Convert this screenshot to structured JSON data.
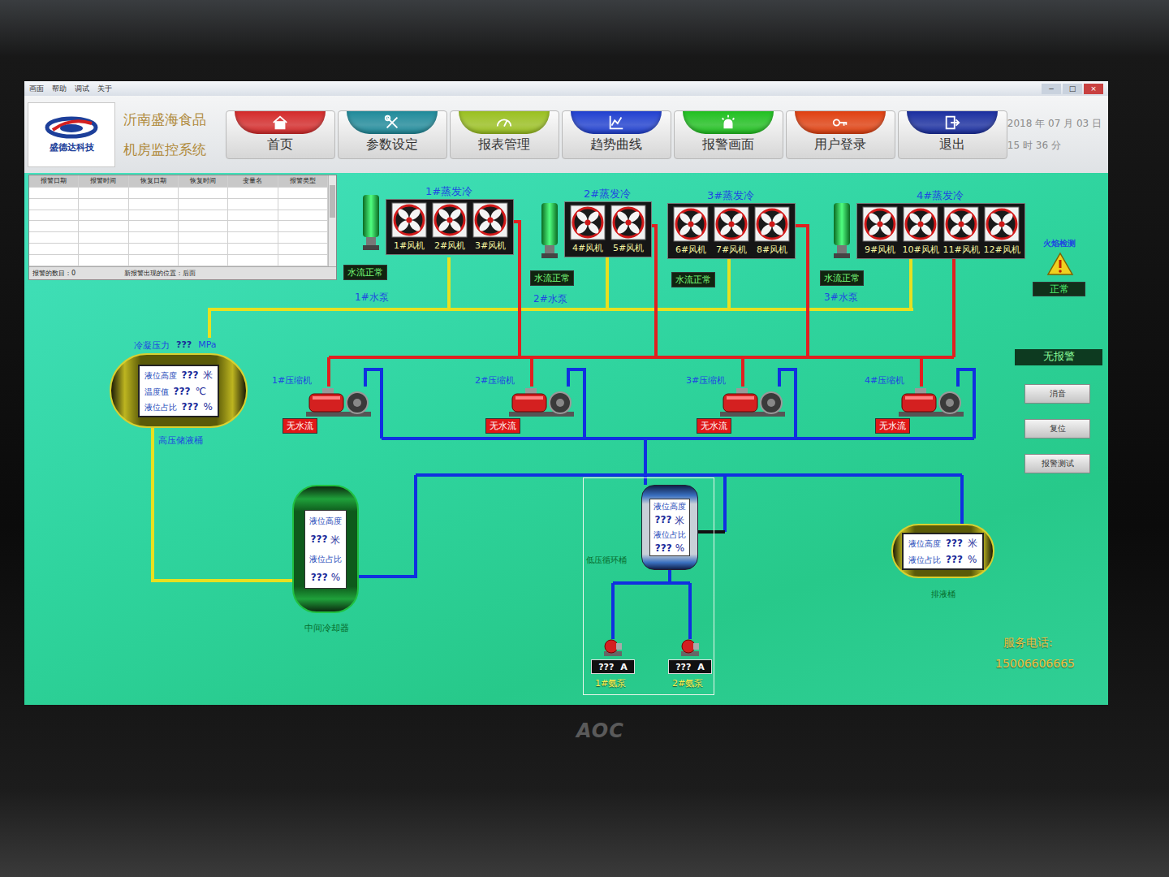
{
  "window": {
    "menu": [
      "画面",
      "帮助",
      "调试",
      "关于"
    ],
    "controls": [
      "−",
      "□",
      "×"
    ]
  },
  "header": {
    "logo": "盛德达科技",
    "company": "沂南盛海食品",
    "system": "机房监控系统",
    "date": "2018 年 07 月 03 日",
    "time": "15 时 36 分"
  },
  "nav": [
    {
      "label": "首页",
      "color": "#d42a2a"
    },
    {
      "label": "参数设定",
      "color": "#1f8a9a"
    },
    {
      "label": "报表管理",
      "color": "#9ac020"
    },
    {
      "label": "趋势曲线",
      "color": "#2040d0"
    },
    {
      "label": "报警画面",
      "color": "#20c020"
    },
    {
      "label": "用户登录",
      "color": "#e04010"
    },
    {
      "label": "退出",
      "color": "#1a2ea0"
    }
  ],
  "alarm_table": {
    "columns": [
      "报警日期",
      "报警时间",
      "恢复日期",
      "恢复时间",
      "变量名",
      "报警类型"
    ],
    "rows": [],
    "count": "报警的数目：0",
    "position": "新报警出现的位置：后面"
  },
  "condensers": [
    {
      "title": "1#蒸发冷",
      "fans": [
        "1#风机",
        "2#风机",
        "3#风机"
      ],
      "flow": "水流正常",
      "flow_ok": true,
      "pump": "1#水泵"
    },
    {
      "title": "2#蒸发冷",
      "fans": [
        "4#风机",
        "5#风机"
      ],
      "flow": "水流正常",
      "flow_ok": true,
      "pump": "2#水泵"
    },
    {
      "title": "3#蒸发冷",
      "fans": [
        "6#风机",
        "7#风机",
        "8#风机"
      ],
      "flow": "水流正常",
      "flow_ok": true
    },
    {
      "title": "4#蒸发冷",
      "fans": [
        "9#风机",
        "10#风机",
        "11#风机",
        "12#风机"
      ],
      "flow": "水流正常",
      "flow_ok": true,
      "pump": "3#水泵"
    }
  ],
  "compressors": [
    {
      "label": "1#压缩机",
      "status": "无水流",
      "flow_ok": false
    },
    {
      "label": "2#压缩机",
      "status": "无水流",
      "flow_ok": false
    },
    {
      "label": "3#压缩机",
      "status": "无水流",
      "flow_ok": false
    },
    {
      "label": "4#压缩机",
      "status": "无水流",
      "flow_ok": false
    }
  ],
  "fire": {
    "title": "火焰检测",
    "status": "正常",
    "ok": true
  },
  "alarm_status": "无报警",
  "buttons": [
    "消音",
    "复位",
    "报警测试"
  ],
  "receiver": {
    "title_label": "冷凝压力",
    "title_value": "???",
    "title_unit": "MPa",
    "rows": [
      {
        "label": "液位高度",
        "value": "???",
        "unit": "米"
      },
      {
        "label": "温度值",
        "value": "???",
        "unit": "℃"
      },
      {
        "label": "液位占比",
        "value": "???",
        "unit": "%"
      }
    ],
    "name": "高压储液桶"
  },
  "cooler": {
    "rows": [
      {
        "label": "液位高度",
        "value": "???",
        "unit": "米"
      },
      {
        "label": "液位占比",
        "value": "???",
        "unit": "%"
      }
    ],
    "name": "中间冷却器"
  },
  "low_barrel": {
    "rows": [
      {
        "label": "液位高度",
        "value": "???",
        "unit": "米"
      },
      {
        "label": "液位占比",
        "value": "???",
        "unit": "%"
      }
    ],
    "name": "低压循环桶",
    "pumps": [
      {
        "value": "???",
        "unit": "A",
        "name": "1#氨泵"
      },
      {
        "value": "???",
        "unit": "A",
        "name": "2#氨泵"
      }
    ]
  },
  "drain": {
    "rows": [
      {
        "label": "液位高度",
        "value": "???",
        "unit": "米"
      },
      {
        "label": "液位占比",
        "value": "???",
        "unit": "%"
      }
    ],
    "name": "排液桶"
  },
  "service": {
    "label": "服务电话:",
    "phone": "15006606665"
  },
  "bezel": {
    "brand": "AOC"
  }
}
